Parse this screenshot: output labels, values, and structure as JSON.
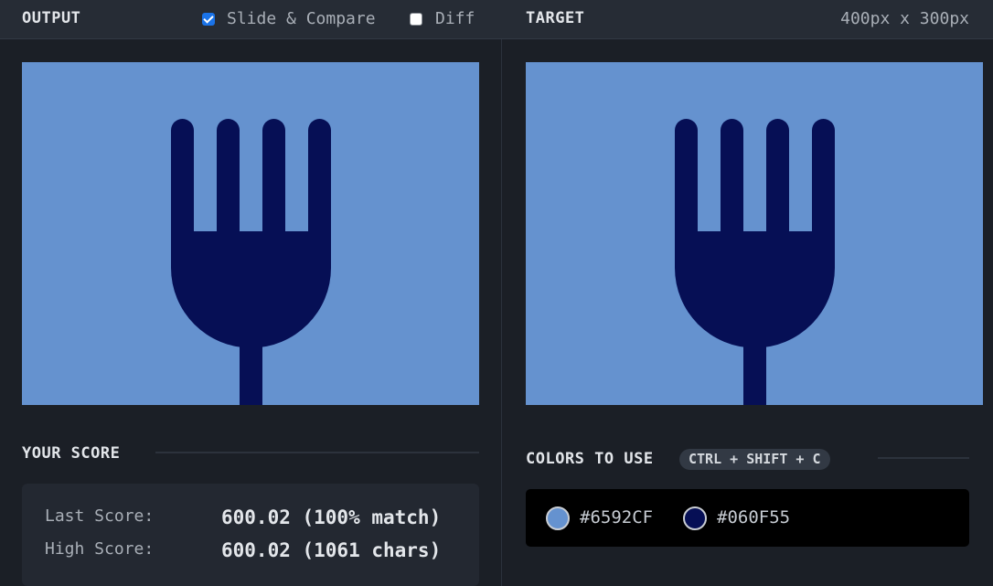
{
  "header": {
    "output_title": "OUTPUT",
    "slide_compare": {
      "label": "Slide & Compare",
      "checked": true
    },
    "diff": {
      "label": "Diff",
      "checked": false
    },
    "target_title": "TARGET",
    "dimensions": "400px x 300px"
  },
  "score": {
    "title": "YOUR SCORE",
    "last_label": "Last Score:",
    "last_value": "600.02 (100% match)",
    "high_label": "High Score:",
    "high_value": "600.02 (1061 chars)"
  },
  "colors": {
    "title": "COLORS TO USE",
    "shortcut": "CTRL + SHIFT + C",
    "items": [
      {
        "hex": "#6592CF",
        "label": "#6592CF",
        "icon": "color-swatch"
      },
      {
        "hex": "#060F55",
        "label": "#060F55",
        "icon": "color-swatch"
      }
    ]
  }
}
